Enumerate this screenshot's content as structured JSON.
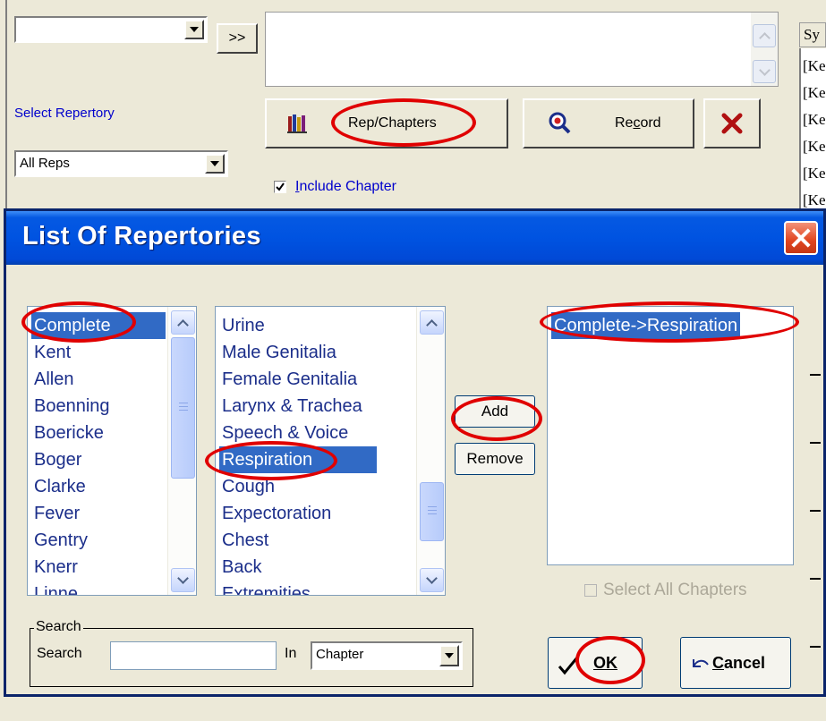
{
  "app": {
    "top_combo_value": "",
    "expand_button_label": ">>",
    "select_repertory_label": "Select Repertory",
    "repertory_combo_value": "All Reps",
    "rep_chapters_label": "Rep/Chapters",
    "record_label": "Record",
    "include_chapter": {
      "label": "Include Chapter",
      "checked": true
    },
    "symptom_header": "Sy",
    "symptom_rows": [
      "[Ke",
      "[Ke",
      "[Ke",
      "[Ke",
      "[Ke",
      "[Ke"
    ]
  },
  "dialog": {
    "title": "List Of Repertories",
    "repertories": [
      "Complete",
      "Kent",
      "Allen",
      "Boenning",
      "Boericke",
      "Boger",
      "Clarke",
      "Fever",
      "Gentry",
      "Knerr",
      "Linne"
    ],
    "selected_repertory": "Complete",
    "chapters": [
      "Urine",
      "Male Genitalia",
      "Female Genitalia",
      "Larynx & Trachea",
      "Speech & Voice",
      "Respiration",
      "Cough",
      "Expectoration",
      "Chest",
      "Back",
      "Extremities"
    ],
    "selected_chapter": "Respiration",
    "add_label": "Add",
    "remove_label": "Remove",
    "selected_items": [
      "Complete->Respiration"
    ],
    "select_all_chapters": {
      "label": "Select All Chapters",
      "checked": false,
      "enabled": false
    },
    "search": {
      "group_label": "Search",
      "field_label": "Search",
      "value": "",
      "in_label": "In",
      "in_value": "Chapter"
    },
    "ok_label": "OK",
    "cancel_label": "Cancel"
  },
  "colors": {
    "highlight_ring": "#e00000",
    "selection": "#316ac5",
    "list_text": "#1b2e8a",
    "link_blue": "#0000cc"
  },
  "icons": {
    "rep_chapters": "books-icon",
    "record": "search-record-icon",
    "delete": "red-x-icon",
    "ok": "checkmark-icon",
    "cancel": "undo-arrow-icon"
  }
}
